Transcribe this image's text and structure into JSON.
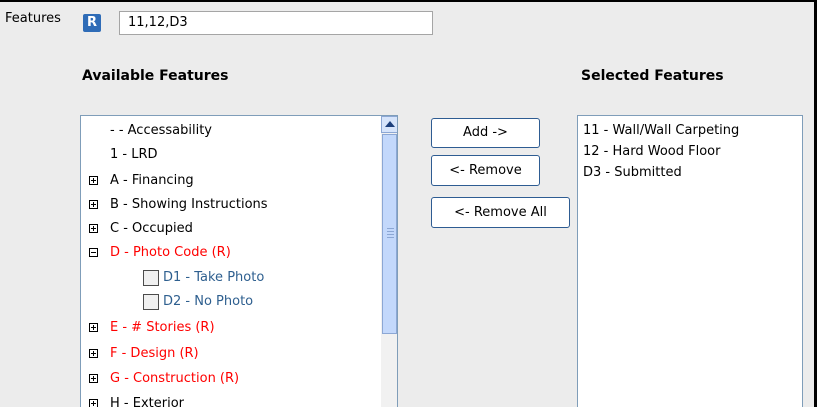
{
  "features": {
    "label": "Features",
    "badge": "R",
    "value": "11,12,D3"
  },
  "available": {
    "header": "Available Features",
    "items": [
      {
        "label": "- - Accessability",
        "expander": "none",
        "required": false
      },
      {
        "label": "1 - LRD",
        "expander": "none",
        "required": false
      },
      {
        "label": "A - Financing",
        "expander": "plus",
        "required": false
      },
      {
        "label": "B - Showing Instructions",
        "expander": "plus",
        "required": false
      },
      {
        "label": "C - Occupied",
        "expander": "plus",
        "required": false
      },
      {
        "label": "D - Photo Code (R)",
        "expander": "minus",
        "required": true
      },
      {
        "label": "D1 - Take Photo",
        "checked": false
      },
      {
        "label": "D2 - No Photo",
        "checked": false
      },
      {
        "label": "E - # Stories (R)",
        "expander": "plus",
        "required": true
      },
      {
        "label": "F - Design (R)",
        "expander": "plus",
        "required": true
      },
      {
        "label": "G - Construction (R)",
        "expander": "plus",
        "required": true
      },
      {
        "label": "H - Exterior",
        "expander": "plus",
        "required": false
      }
    ]
  },
  "buttons": {
    "add": "Add ->",
    "remove": "<- Remove",
    "remove_all": "<- Remove All"
  },
  "selected": {
    "header": "Selected Features",
    "items": [
      "11 - Wall/Wall Carpeting",
      "12 - Hard Wood Floor",
      "D3 - Submitted"
    ]
  },
  "colors": {
    "required_text": "#ff0000",
    "child_text": "#2e5f8f",
    "badge": "#2f6cb7"
  }
}
